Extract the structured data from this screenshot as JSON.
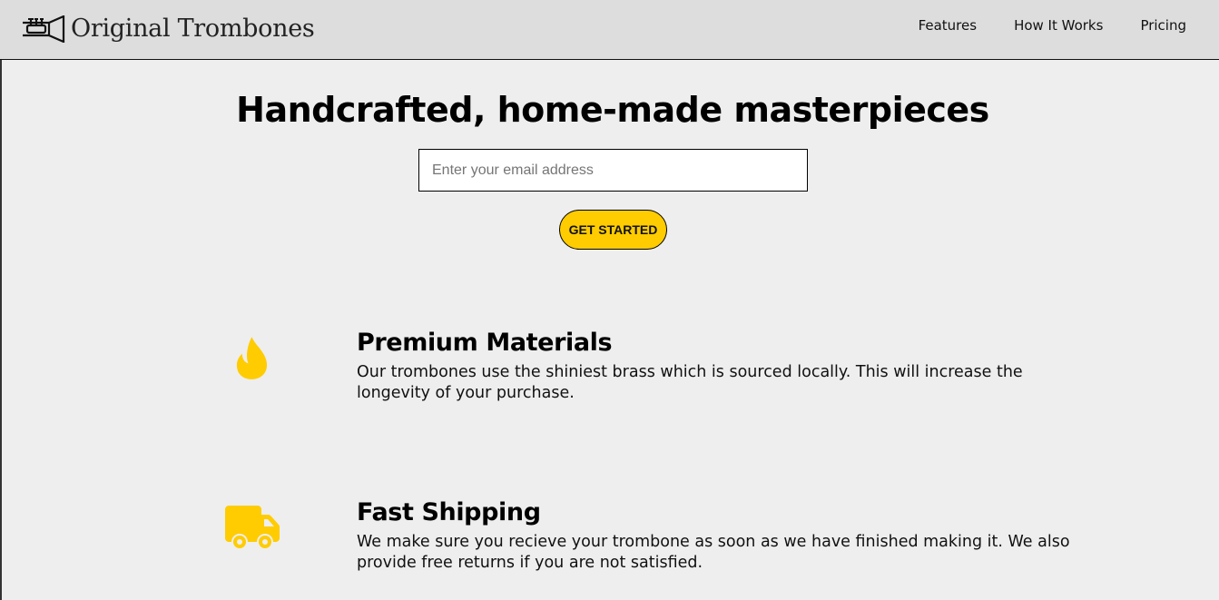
{
  "header": {
    "logo_text": "Original Trombones",
    "nav": [
      {
        "label": "Features"
      },
      {
        "label": "How It Works"
      },
      {
        "label": "Pricing"
      }
    ]
  },
  "hero": {
    "title": "Handcrafted, home-made masterpieces",
    "email_placeholder": "Enter your email address",
    "cta_label": "GET STARTED"
  },
  "features": [
    {
      "icon": "fire-icon",
      "title": "Premium Materials",
      "description": "Our trombones use the shiniest brass which is sourced locally. This will increase the longevity of your purchase."
    },
    {
      "icon": "truck-icon",
      "title": "Fast Shipping",
      "description": "We make sure you recieve your trombone as soon as we have finished making it. We also provide free returns if you are not satisfied."
    }
  ],
  "colors": {
    "accent": "#fecc00",
    "header_bg": "#dddddd",
    "page_bg": "#eeeeee"
  }
}
